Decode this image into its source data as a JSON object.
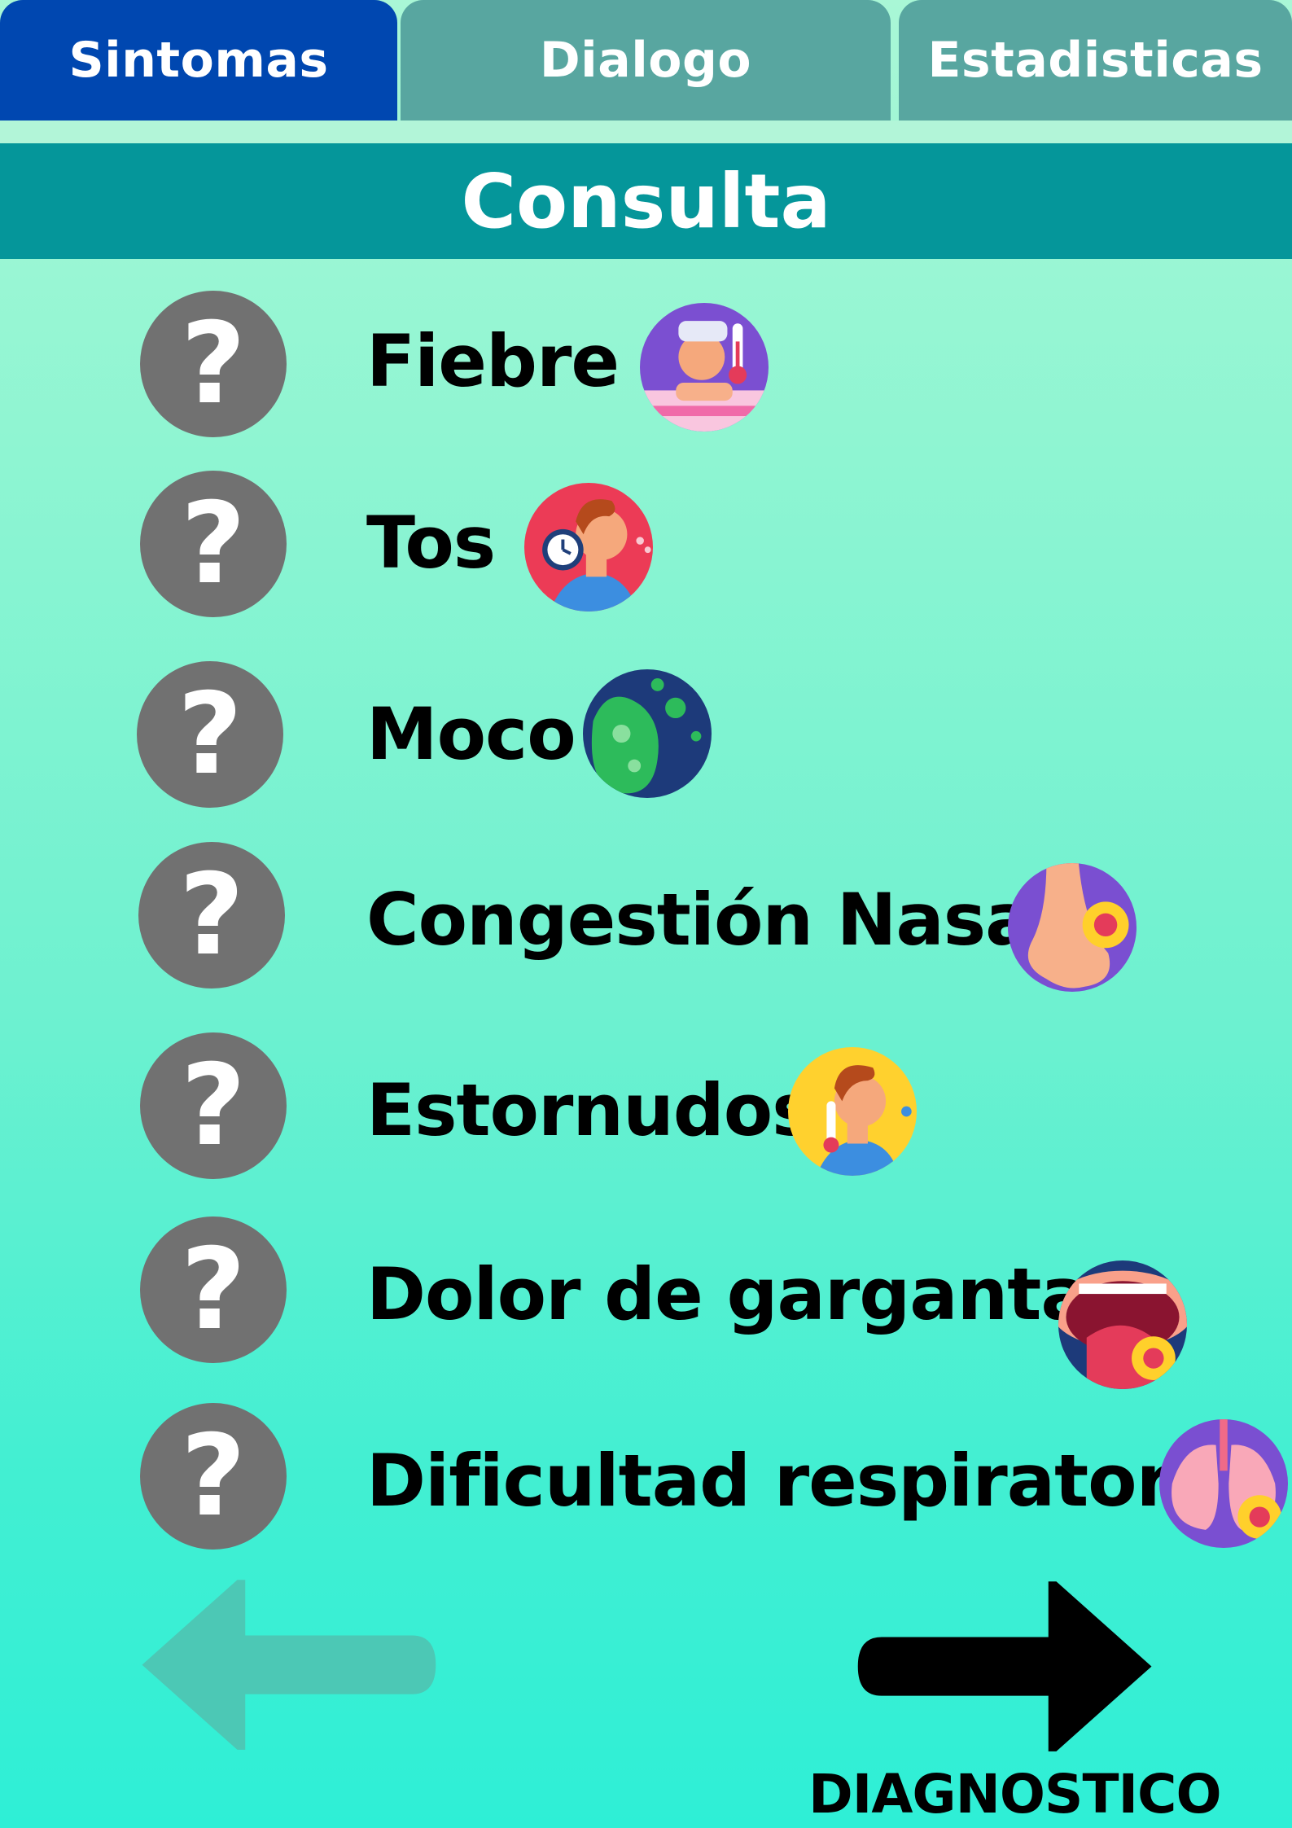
{
  "tabs": [
    {
      "label": "Sintomas",
      "active": true
    },
    {
      "label": "Dialogo",
      "active": false
    },
    {
      "label": "Estadisticas",
      "active": false
    }
  ],
  "header": {
    "title": "Consulta"
  },
  "symptoms": [
    {
      "label": "Fiebre",
      "status_glyph": "?",
      "icon": "fever-icon"
    },
    {
      "label": "Tos",
      "status_glyph": "?",
      "icon": "cough-icon"
    },
    {
      "label": "Moco",
      "status_glyph": "?",
      "icon": "mucus-virus-icon"
    },
    {
      "label": "Congestión Nasal",
      "status_glyph": "?",
      "icon": "nasal-congestion-icon"
    },
    {
      "label": "Estornudos",
      "status_glyph": "?",
      "icon": "sneeze-icon"
    },
    {
      "label": "Dolor de garganta",
      "status_glyph": "?",
      "icon": "sore-throat-icon"
    },
    {
      "label": "Dificultad respiratoria",
      "status_glyph": "?",
      "icon": "lungs-virus-icon"
    }
  ],
  "nav": {
    "back_icon": "arrow-left-icon",
    "next_icon": "arrow-right-icon",
    "next_label": "DIAGNOSTICO"
  },
  "colors": {
    "active_tab": "#0047b0",
    "inactive_tab": "#58a6a0",
    "header": "#05969a",
    "status_circle": "#717171",
    "back_arrow": "#4cc8b5"
  }
}
